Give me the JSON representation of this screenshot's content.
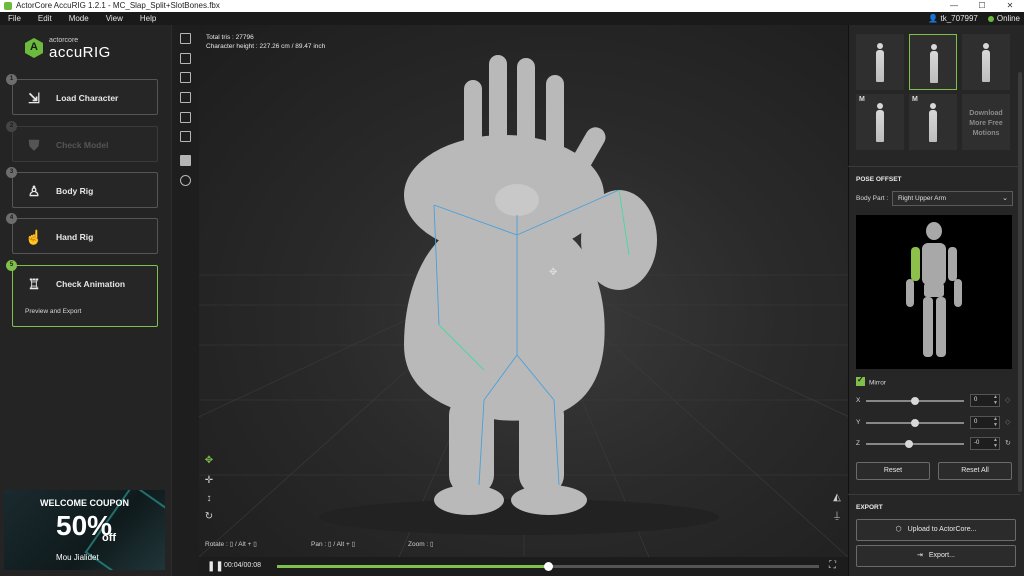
{
  "window": {
    "title": "ActorCore AccuRIG 1.2.1 - MC_Slap_Split+SlotBones.fbx",
    "controls": [
      "—",
      "☐",
      "✕"
    ]
  },
  "menu": {
    "items": [
      "File",
      "Edit",
      "Mode",
      "View",
      "Help"
    ],
    "user": "tk_707997",
    "status": "Online"
  },
  "logo": {
    "sub": "actorcore",
    "main": "accuRIG"
  },
  "steps": [
    {
      "num": "1",
      "label": "Load Character",
      "icon": "folder-import-icon",
      "glyph": "⇲",
      "state": "done"
    },
    {
      "num": "2",
      "label": "Check Model",
      "icon": "model-check-icon",
      "glyph": "⛊",
      "state": "disabled"
    },
    {
      "num": "3",
      "label": "Body Rig",
      "icon": "body-rig-icon",
      "glyph": "♙",
      "state": "done"
    },
    {
      "num": "4",
      "label": "Hand Rig",
      "icon": "hand-rig-icon",
      "glyph": "☝",
      "state": "done"
    },
    {
      "num": "5",
      "label": "Check Animation",
      "icon": "check-animation-icon",
      "glyph": "♖",
      "state": "active",
      "desc": "Preview and Export"
    }
  ],
  "coupon": {
    "title": "WELCOME COUPON",
    "percent": "50%",
    "off": "off",
    "footer": "Mou Jialidet"
  },
  "viewport": {
    "total_tris": "Total tris : 27796",
    "char_height": "Character height : 227.26 cm / 89.47 inch",
    "hints": {
      "rotate": "Rotate :",
      "rotate_keys": "/ Alt +",
      "pan": "Pan :",
      "pan_keys": "/ Alt +",
      "zoom": "Zoom :"
    }
  },
  "timeline": {
    "time": "00:04/00:08",
    "progress": 0.5
  },
  "motions": [
    {
      "tag": ""
    },
    {
      "tag": ""
    },
    {
      "tag": ""
    },
    {
      "tag": "M"
    },
    {
      "tag": "M"
    }
  ],
  "more_motions": "Download More Free Motions",
  "pose_offset": {
    "title": "POSE OFFSET",
    "body_part_label": "Body Part :",
    "body_part_value": "Right Upper Arm",
    "mirror_label": "Mirror",
    "mirror_checked": true,
    "axes": [
      {
        "name": "X",
        "value": "0",
        "slider": 0.5
      },
      {
        "name": "Y",
        "value": "0",
        "slider": 0.5
      },
      {
        "name": "Z",
        "value": "-0",
        "slider": 0.44
      }
    ],
    "reset": "Reset",
    "reset_all": "Reset All"
  },
  "export": {
    "title": "EXPORT",
    "upload": "Upload to ActorCore...",
    "export": "Export..."
  },
  "colors": {
    "accent": "#7fc04a",
    "panel": "#262626",
    "viewport": "#2a2a2a"
  }
}
